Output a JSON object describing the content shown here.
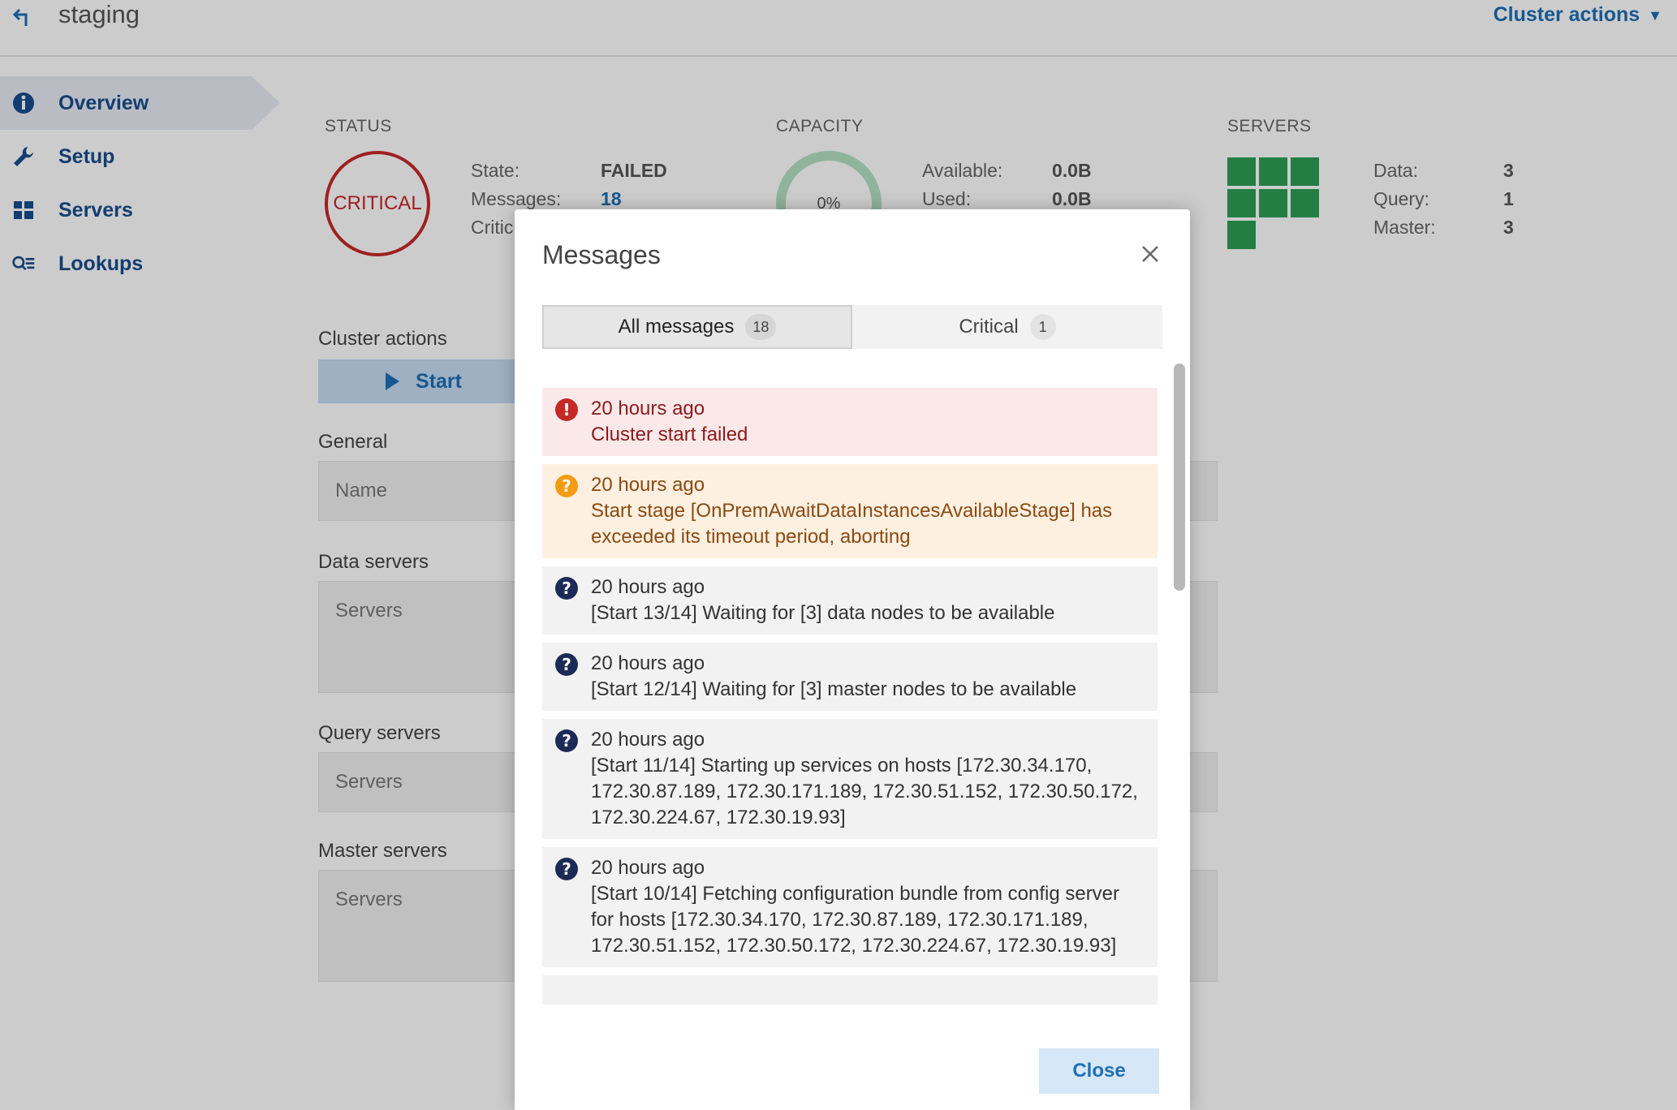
{
  "header": {
    "cluster_name": "staging",
    "cluster_actions_label": "Cluster actions"
  },
  "sidebar": {
    "items": [
      {
        "label": "Overview",
        "icon": "info-icon",
        "active": true
      },
      {
        "label": "Setup",
        "icon": "wrench-icon",
        "active": false
      },
      {
        "label": "Servers",
        "icon": "grid-icon",
        "active": false
      },
      {
        "label": "Lookups",
        "icon": "lookup-icon",
        "active": false
      }
    ]
  },
  "status": {
    "heading": "STATUS",
    "badge": "CRITICAL",
    "state_label": "State:",
    "state_value": "FAILED",
    "messages_label": "Messages:",
    "messages_value": "18",
    "critical_label": "Critic"
  },
  "capacity": {
    "heading": "CAPACITY",
    "percent": "0%",
    "available_label": "Available:",
    "available_value": "0.0B",
    "used_label": "Used:",
    "used_value": "0.0B"
  },
  "servers": {
    "heading": "SERVERS",
    "data_label": "Data:",
    "data_value": "3",
    "query_label": "Query:",
    "query_value": "1",
    "master_label": "Master:",
    "master_value": "3",
    "grid_cells": 7,
    "grid_color": "#2e9e55"
  },
  "main": {
    "cluster_actions_label": "Cluster actions",
    "start_label": "Start",
    "general_label": "General",
    "name_field": "Name",
    "data_servers_label": "Data servers",
    "data_servers_field": "Servers",
    "query_servers_label": "Query servers",
    "query_servers_field": "Servers",
    "master_servers_label": "Master servers",
    "master_servers_field": "Servers"
  },
  "modal": {
    "title": "Messages",
    "tabs": [
      {
        "label": "All messages",
        "count": "18",
        "active": true
      },
      {
        "label": "Critical",
        "count": "1",
        "active": false
      }
    ],
    "messages": [
      {
        "severity": "error",
        "time": "20 hours ago",
        "text": "Cluster start failed"
      },
      {
        "severity": "warning",
        "time": "20 hours ago",
        "text": "Start stage [OnPremAwaitDataInstancesAvailableStage] has exceeded its timeout period, aborting"
      },
      {
        "severity": "info",
        "time": "20 hours ago",
        "text": "[Start 13/14] Waiting for [3] data nodes to be available"
      },
      {
        "severity": "info",
        "time": "20 hours ago",
        "text": "[Start 12/14] Waiting for [3] master nodes to be available"
      },
      {
        "severity": "info",
        "time": "20 hours ago",
        "text": "[Start 11/14] Starting up services on hosts [172.30.34.170, 172.30.87.189, 172.30.171.189, 172.30.51.152, 172.30.50.172, 172.30.224.67, 172.30.19.93]"
      },
      {
        "severity": "info",
        "time": "20 hours ago",
        "text": "[Start 10/14] Fetching configuration bundle from config server for hosts [172.30.34.170, 172.30.87.189, 172.30.171.189, 172.30.51.152, 172.30.50.172, 172.30.224.67, 172.30.19.93]"
      }
    ],
    "close_label": "Close"
  },
  "colors": {
    "accent": "#1f6fb6",
    "critical": "#c62828",
    "warning": "#f39c12",
    "info": "#1b2a57",
    "success": "#2e9e55"
  }
}
